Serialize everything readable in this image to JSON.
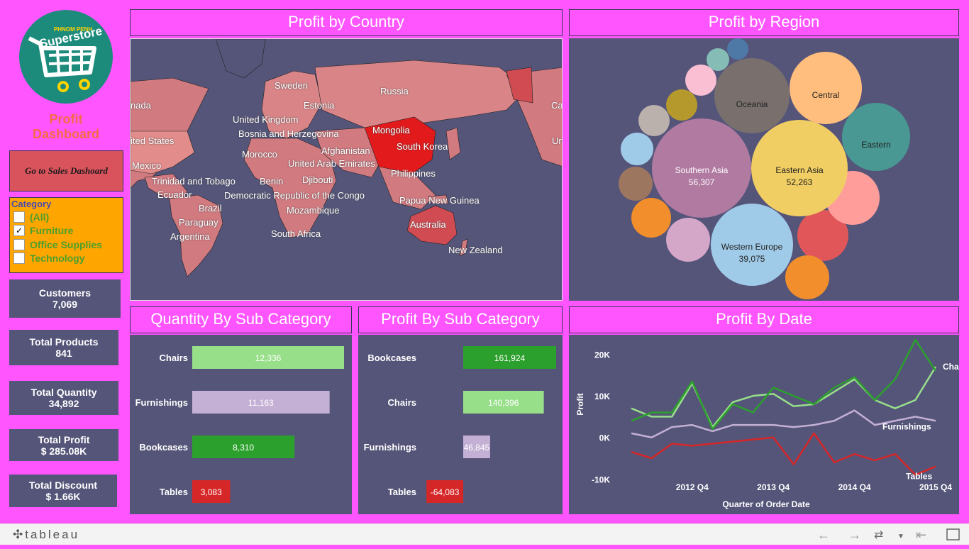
{
  "logo": {
    "brand_small": "PHNOM PENH",
    "brand": "Superstore"
  },
  "sidebar": {
    "title_line1": "Profit",
    "title_line2": "Dashboard",
    "sales_button": "Go to Sales Dashoard",
    "filter": {
      "header": "Category",
      "options": [
        {
          "label": "(All)",
          "checked": false
        },
        {
          "label": "Furniture",
          "checked": true
        },
        {
          "label": "Office Supplies",
          "checked": false
        },
        {
          "label": "Technology",
          "checked": false
        }
      ]
    },
    "kpis": [
      {
        "label": "Customers",
        "value": "7,069"
      },
      {
        "label": "Total Products",
        "value": "841"
      },
      {
        "label": "Total Quantity",
        "value": "34,892"
      },
      {
        "label": "Total Profit",
        "value": "$ 285.08K"
      },
      {
        "label": "Total Discount",
        "value": "$ 1.66K"
      }
    ]
  },
  "map": {
    "title": "Profit by Country",
    "labels": [
      "Sweden",
      "Russia",
      "Estonia",
      "United Kingdom",
      "Bosnia and Herzegovina",
      "Mongolia",
      "Afghanistan",
      "South Korea",
      "Morocco",
      "United Arab Emirates",
      "Philippines",
      "Trinidad and Tobago",
      "Benin",
      "Djibouti",
      "Ecuador",
      "Democratic Republic of the Congo",
      "Papua New Guinea",
      "Brazil",
      "Mozambique",
      "Paraguay",
      "Australia",
      "Argentina",
      "South Africa",
      "New Zealand",
      "Mexico",
      "ited States",
      "nada",
      "Ca",
      "Un"
    ]
  },
  "region": {
    "title": "Profit by Region",
    "bubbles": [
      {
        "name": "Southern Asia",
        "value": "56,307",
        "color": "#b07aa1"
      },
      {
        "name": "Eastern Asia",
        "value": "52,263",
        "color": "#f1ce63"
      },
      {
        "name": "Western Europe",
        "value": "39,075",
        "color": "#a0cbe8"
      },
      {
        "name": "Oceania",
        "value": "",
        "color": "#79706e"
      },
      {
        "name": "Central",
        "value": "",
        "color": "#ffbe7d"
      },
      {
        "name": "Eastern",
        "value": "",
        "color": "#499894"
      }
    ]
  },
  "quantity": {
    "title": "Quantity By Sub Category",
    "chart_data": {
      "type": "bar",
      "categories": [
        "Chairs",
        "Furnishings",
        "Bookcases",
        "Tables"
      ],
      "values": [
        12336,
        11163,
        8310,
        3083
      ],
      "labels": [
        "12,336",
        "11,163",
        "8,310",
        "3,083"
      ],
      "colors": [
        "#98df8a",
        "#c5b0d5",
        "#2ca02c",
        "#d62728"
      ]
    }
  },
  "profit_sub": {
    "title": "Profit By Sub Category",
    "chart_data": {
      "type": "bar",
      "categories": [
        "Bookcases",
        "Chairs",
        "Furnishings",
        "Tables"
      ],
      "values": [
        161924,
        140396,
        46845,
        -64083
      ],
      "labels": [
        "161,924",
        "140,396",
        "46,845",
        "-64,083"
      ],
      "colors": [
        "#2ca02c",
        "#98df8a",
        "#c5b0d5",
        "#d62728"
      ]
    }
  },
  "profit_date": {
    "title": "Profit By Date",
    "chart_data": {
      "type": "line",
      "xlabel": "Quarter of Order Date",
      "ylabel": "Profit",
      "ylim": [
        -12000,
        23000
      ],
      "yticks": [
        "20K",
        "10K",
        "0K",
        "-10K"
      ],
      "yticks_values": [
        20000,
        10000,
        0,
        -10000
      ],
      "xticks": [
        "2012 Q4",
        "2013 Q4",
        "2014 Q4",
        "2015 Q4"
      ],
      "x": [
        "2012 Q1",
        "2012 Q2",
        "2012 Q3",
        "2012 Q4",
        "2013 Q1",
        "2013 Q2",
        "2013 Q3",
        "2013 Q4",
        "2014 Q1",
        "2014 Q2",
        "2014 Q3",
        "2014 Q4",
        "2015 Q1",
        "2015 Q2",
        "2015 Q3",
        "2015 Q4"
      ],
      "series": [
        {
          "name": "Chairs",
          "color": "#98df8a",
          "values": [
            7000,
            5000,
            5000,
            13000,
            2500,
            8500,
            10000,
            10500,
            7500,
            8000,
            11000,
            14000,
            9000,
            7000,
            9000,
            17000
          ]
        },
        {
          "name": "",
          "color": "#2ca02c",
          "values": [
            4000,
            6000,
            6000,
            13500,
            2000,
            8000,
            6000,
            12000,
            10000,
            8000,
            12000,
            14500,
            9000,
            14000,
            23500,
            16000
          ]
        },
        {
          "name": "Furnishings",
          "color": "#c5b0d5",
          "values": [
            1000,
            0,
            2500,
            3000,
            1500,
            3000,
            3000,
            3000,
            2500,
            3000,
            4000,
            6500,
            3000,
            4000,
            5000,
            4000
          ]
        },
        {
          "name": "Tables",
          "color": "#d62728",
          "values": [
            -3500,
            -5000,
            -1500,
            -2000,
            -1500,
            -1000,
            -500,
            0,
            -6500,
            1000,
            -6000,
            -4000,
            -5500,
            -4000,
            -9000,
            -7000
          ]
        }
      ]
    }
  }
}
